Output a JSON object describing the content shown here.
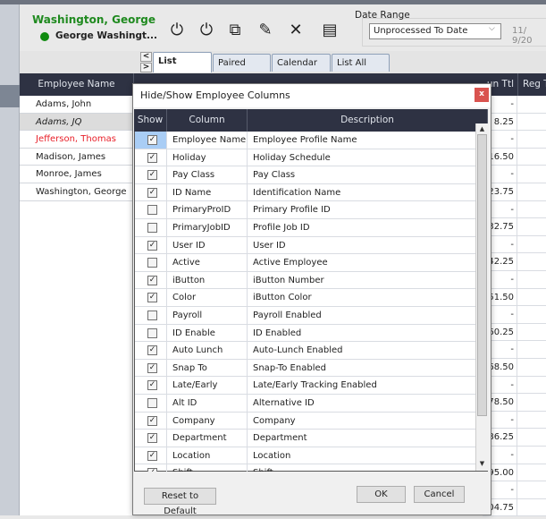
{
  "header": {
    "employee_name": "Washington, George",
    "employee_sub": "George Washingt...",
    "status_color": "#0f8a0f",
    "tools": [
      {
        "icon": "punch-in-icon",
        "glyph": "⏻"
      },
      {
        "icon": "punch-out-icon",
        "glyph": "⏻"
      },
      {
        "icon": "add-entry-icon",
        "glyph": "⧉"
      },
      {
        "icon": "edit-icon",
        "glyph": "✎"
      },
      {
        "icon": "delete-icon",
        "glyph": "✕"
      },
      {
        "icon": "columns-icon",
        "glyph": "▤"
      }
    ],
    "date_range_label": "Date Range",
    "date_range_value": "Unprocessed To Date",
    "date_start": "11/ 9/20"
  },
  "tabs": [
    "List",
    "Paired",
    "Calendar",
    "List All"
  ],
  "grid": {
    "name_header": "Employee Name",
    "total_header": "un Ttl",
    "reg_header": "Reg T",
    "employees": [
      {
        "name": "Adams, John",
        "style": "normal"
      },
      {
        "name": "Adams, JQ",
        "style": "italic"
      },
      {
        "name": "Jefferson, Thomas",
        "style": "red"
      },
      {
        "name": "Madison, James",
        "style": "normal"
      },
      {
        "name": "Monroe, James",
        "style": "normal"
      },
      {
        "name": "Washington, George",
        "style": "normal"
      }
    ],
    "totals": [
      "-",
      "8.25",
      "-",
      "16.50",
      "-",
      "23.75",
      "-",
      "32.75",
      "-",
      "42.25",
      "-",
      "51.50",
      "-",
      "60.25",
      "-",
      "68.50",
      "-",
      "78.50",
      "-",
      "86.25",
      "-",
      "95.00",
      "-",
      "104.75"
    ]
  },
  "dialog": {
    "title": "Hide/Show Employee Columns",
    "close": "x",
    "headers": {
      "show": "Show",
      "column": "Column",
      "description": "Description"
    },
    "rows": [
      {
        "column": "Employee Name",
        "description": "Employee Profile Name",
        "show": true
      },
      {
        "column": "Holiday",
        "description": "Holiday Schedule",
        "show": true
      },
      {
        "column": "Pay Class",
        "description": "Pay Class",
        "show": true
      },
      {
        "column": "ID Name",
        "description": "Identification Name",
        "show": true
      },
      {
        "column": "PrimaryProID",
        "description": "Primary Profile ID",
        "show": false
      },
      {
        "column": "PrimaryJobID",
        "description": "Profile Job ID",
        "show": false
      },
      {
        "column": "User ID",
        "description": "User ID",
        "show": true
      },
      {
        "column": "Active",
        "description": "Active Employee",
        "show": false
      },
      {
        "column": "iButton",
        "description": "iButton Number",
        "show": true
      },
      {
        "column": "Color",
        "description": "iButton Color",
        "show": true
      },
      {
        "column": "Payroll",
        "description": "Payroll Enabled",
        "show": false
      },
      {
        "column": "ID Enable",
        "description": "ID Enabled",
        "show": false
      },
      {
        "column": "Auto Lunch",
        "description": "Auto-Lunch Enabled",
        "show": true
      },
      {
        "column": "Snap To",
        "description": "Snap-To Enabled",
        "show": true
      },
      {
        "column": "Late/Early",
        "description": "Late/Early Tracking Enabled",
        "show": true
      },
      {
        "column": "Alt ID",
        "description": "Alternative ID",
        "show": false
      },
      {
        "column": "Company",
        "description": "Company",
        "show": true
      },
      {
        "column": "Department",
        "description": "Department",
        "show": true
      },
      {
        "column": "Location",
        "description": "Location",
        "show": true
      },
      {
        "column": "Shift",
        "description": "Shift",
        "show": true
      }
    ],
    "reset_label": "Reset to Default",
    "ok_label": "OK",
    "cancel_label": "Cancel"
  }
}
